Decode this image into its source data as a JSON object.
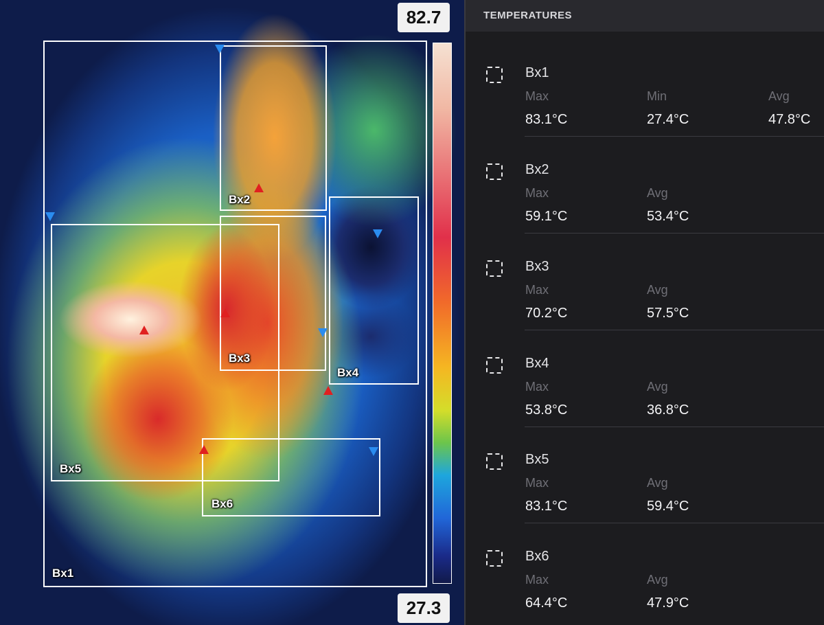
{
  "scale": {
    "max": "82.7",
    "min": "27.3"
  },
  "colors": {
    "panel_bg": "#1c1c1f",
    "header_bg": "#29292e",
    "max_marker": "#e02020",
    "min_marker": "#2a8cf0"
  },
  "rois": [
    {
      "id": "bx1",
      "label": "Bx1"
    },
    {
      "id": "bx2",
      "label": "Bx2"
    },
    {
      "id": "bx3",
      "label": "Bx3"
    },
    {
      "id": "bx4",
      "label": "Bx4"
    },
    {
      "id": "bx5",
      "label": "Bx5"
    },
    {
      "id": "bx6",
      "label": "Bx6"
    }
  ],
  "panel": {
    "title": "TEMPERATURES",
    "rows": [
      {
        "name": "Bx1",
        "max_label": "Max",
        "max": "83.1°C",
        "min_label": "Min",
        "min": "27.4°C",
        "avg_label": "Avg",
        "avg": "47.8°C"
      },
      {
        "name": "Bx2",
        "max_label": "Max",
        "max": "59.1°C",
        "avg_label": "Avg",
        "avg": "53.4°C"
      },
      {
        "name": "Bx3",
        "max_label": "Max",
        "max": "70.2°C",
        "avg_label": "Avg",
        "avg": "57.5°C"
      },
      {
        "name": "Bx4",
        "max_label": "Max",
        "max": "53.8°C",
        "avg_label": "Avg",
        "avg": "36.8°C"
      },
      {
        "name": "Bx5",
        "max_label": "Max",
        "max": "83.1°C",
        "avg_label": "Avg",
        "avg": "59.4°C"
      },
      {
        "name": "Bx6",
        "max_label": "Max",
        "max": "64.4°C",
        "avg_label": "Avg",
        "avg": "47.9°C"
      }
    ]
  }
}
